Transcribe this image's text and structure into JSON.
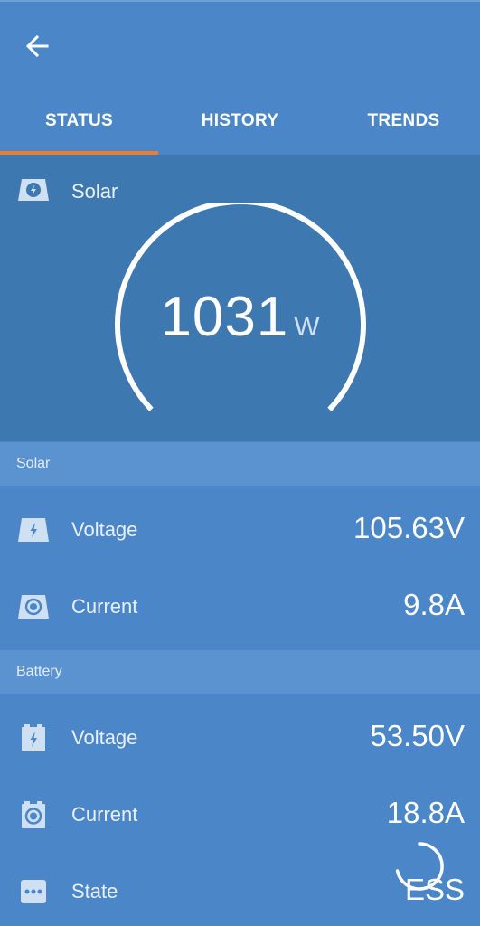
{
  "header": {
    "back_icon": "back-arrow-icon",
    "tabs": [
      {
        "label": "STATUS",
        "active": true
      },
      {
        "label": "HISTORY",
        "active": false
      },
      {
        "label": "TRENDS",
        "active": false
      }
    ],
    "accent_color": "#f07b2c"
  },
  "gauge": {
    "title": "Solar",
    "icon": "solar-panel-icon",
    "value": "1031",
    "unit": "W"
  },
  "solar": {
    "section_title": "Solar",
    "rows": [
      {
        "icon": "solar-voltage-icon",
        "label": "Voltage",
        "value": "105.63V"
      },
      {
        "icon": "solar-current-icon",
        "label": "Current",
        "value": "9.8A"
      }
    ]
  },
  "battery": {
    "section_title": "Battery",
    "rows": [
      {
        "icon": "battery-voltage-icon",
        "label": "Voltage",
        "value": "53.50V"
      },
      {
        "icon": "battery-current-icon",
        "label": "Current",
        "value": "18.8A"
      },
      {
        "icon": "more-dots-icon",
        "label": "State",
        "value": "ESS"
      }
    ]
  },
  "colors": {
    "background": "#4a86c8",
    "gauge_panel": "#3e78b0",
    "section_header": "#5a93d0"
  }
}
